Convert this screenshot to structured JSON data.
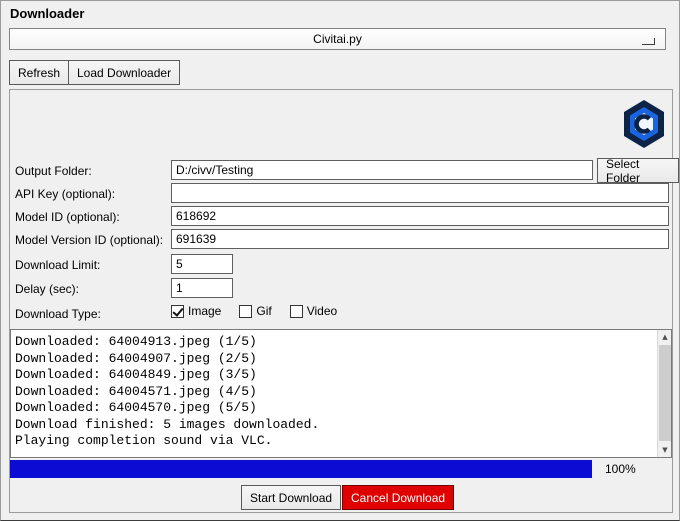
{
  "window": {
    "title": "Downloader"
  },
  "selector": {
    "value": "Civitai.py"
  },
  "toolbar": {
    "refresh_label": "Refresh",
    "load_label": "Load Downloader"
  },
  "form": {
    "output_folder": {
      "label": "Output Folder:",
      "value": "D:/civv/Testing",
      "button_label": "Select Folder"
    },
    "api_key": {
      "label": "API Key (optional):",
      "value": ""
    },
    "model_id": {
      "label": "Model ID (optional):",
      "value": "618692"
    },
    "model_version_id": {
      "label": "Model Version ID (optional):",
      "value": "691639"
    },
    "download_limit": {
      "label": "Download Limit:",
      "value": "5"
    },
    "delay": {
      "label": "Delay (sec):",
      "value": "1"
    },
    "download_type": {
      "label": "Download Type:",
      "options": [
        {
          "label": "Image",
          "checked": true
        },
        {
          "label": "Gif",
          "checked": false
        },
        {
          "label": "Video",
          "checked": false
        }
      ]
    }
  },
  "log": {
    "lines": [
      "Downloaded: 64004913.jpeg (1/5)",
      "Downloaded: 64004907.jpeg (2/5)",
      "Downloaded: 64004849.jpeg (3/5)",
      "Downloaded: 64004571.jpeg (4/5)",
      "Downloaded: 64004570.jpeg (5/5)",
      "Download finished: 5 images downloaded.",
      "Playing completion sound via VLC."
    ]
  },
  "progress": {
    "value": 100,
    "percent_label": "100%",
    "color": "#0b0bd4"
  },
  "actions": {
    "start_label": "Start Download",
    "cancel_label": "Cancel Download",
    "cancel_bg": "#df0000"
  }
}
